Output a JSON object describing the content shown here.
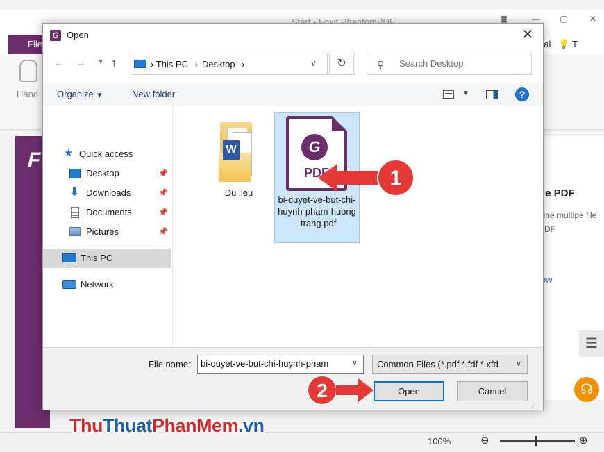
{
  "app": {
    "window_title": "Start - Foxit PhantomPDF",
    "file_tab": "File",
    "tutorial_tab": "rial",
    "tool_hand": "Hand",
    "start_logo": "F",
    "right_panel": {
      "title": "ge PDF",
      "description": "bine multipe file\nPDF",
      "link": "low"
    },
    "status": {
      "zoom": "100%"
    }
  },
  "dialog": {
    "title": "Open",
    "address": {
      "parts": [
        "This PC",
        "Desktop"
      ]
    },
    "search_placeholder": "Search Desktop",
    "toolbar": {
      "organize": "Organize",
      "new_folder": "New folder"
    },
    "nav": {
      "quick_access": "Quick access",
      "items": [
        {
          "label": "Desktop",
          "pinned": true
        },
        {
          "label": "Downloads",
          "pinned": true
        },
        {
          "label": "Documents",
          "pinned": true
        },
        {
          "label": "Pictures",
          "pinned": true
        }
      ],
      "this_pc": "This PC",
      "network": "Network"
    },
    "files": [
      {
        "name": "Du lieu",
        "type": "folder"
      },
      {
        "name": "bi-quyet-ve-but-chi-huynh-pham-huong-trang.pdf",
        "type": "pdf",
        "icon_text": "PDF",
        "selected": true
      }
    ],
    "file_name_label": "File name:",
    "file_name_value": "bi-quyet-ve-but-chi-huynh-pham",
    "file_type_value": "Common Files (*.pdf *.fdf *.xfd",
    "open_button": "Open",
    "cancel_button": "Cancel"
  },
  "annotations": {
    "marker1": "1",
    "marker2": "2"
  },
  "watermark": {
    "part1": "Thu",
    "part2": "Thuat",
    "part3": "PhanMem",
    "part4": ".vn"
  },
  "colors": {
    "foxit_purple": "#6b2d6b",
    "selection": "#cce6fb",
    "marker_red": "#e53935",
    "accent_blue": "#0078d7"
  }
}
